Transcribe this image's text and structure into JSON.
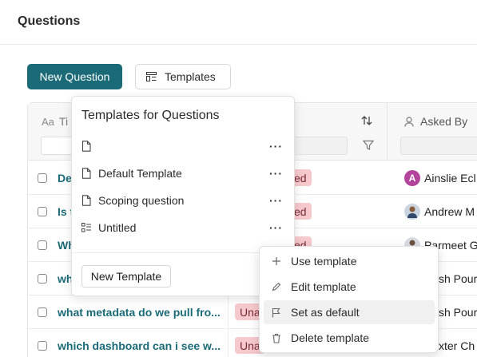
{
  "page": {
    "title": "Questions"
  },
  "toolbar": {
    "new_question_label": "New Question",
    "templates_label": "Templates"
  },
  "table": {
    "header_title": "Ti",
    "header_asked_by": "Asked By",
    "rows": [
      {
        "title": "De",
        "tag": "ed",
        "asked_by": "Ainslie Ecl",
        "avatar": {
          "initial": "A",
          "color": "#b2449b"
        }
      },
      {
        "title": "Is t",
        "tag": "ed",
        "asked_by": "Andrew M"
      },
      {
        "title": "Wh",
        "tag": "ed",
        "asked_by": "Parmeet G"
      },
      {
        "title": "wh",
        "tag": "",
        "asked_by": "sh Pour"
      },
      {
        "title": "what metadata do we pull fro...",
        "tag": "Una",
        "asked_by": "sh Pour"
      },
      {
        "title": "which dashboard can i see w...",
        "tag": "Una",
        "asked_by": "xter Ch"
      }
    ]
  },
  "templates_popover": {
    "title": "Templates for Questions",
    "items": [
      {
        "label": "",
        "icon": "document-icon"
      },
      {
        "label": "Default Template",
        "icon": "document-icon"
      },
      {
        "label": "Scoping question",
        "icon": "document-icon"
      },
      {
        "label": "Untitled",
        "icon": "checklist-icon"
      }
    ],
    "more_label": "···",
    "new_template_label": "New Template"
  },
  "context_menu": {
    "items": [
      {
        "label": "Use template",
        "icon": "plus-icon"
      },
      {
        "label": "Edit template",
        "icon": "pencil-icon"
      },
      {
        "label": "Set as default",
        "icon": "flag-icon"
      },
      {
        "label": "Delete template",
        "icon": "trash-icon"
      }
    ]
  },
  "colors": {
    "accent": "#1b6a78",
    "tag_bg": "#f6c9cd"
  }
}
